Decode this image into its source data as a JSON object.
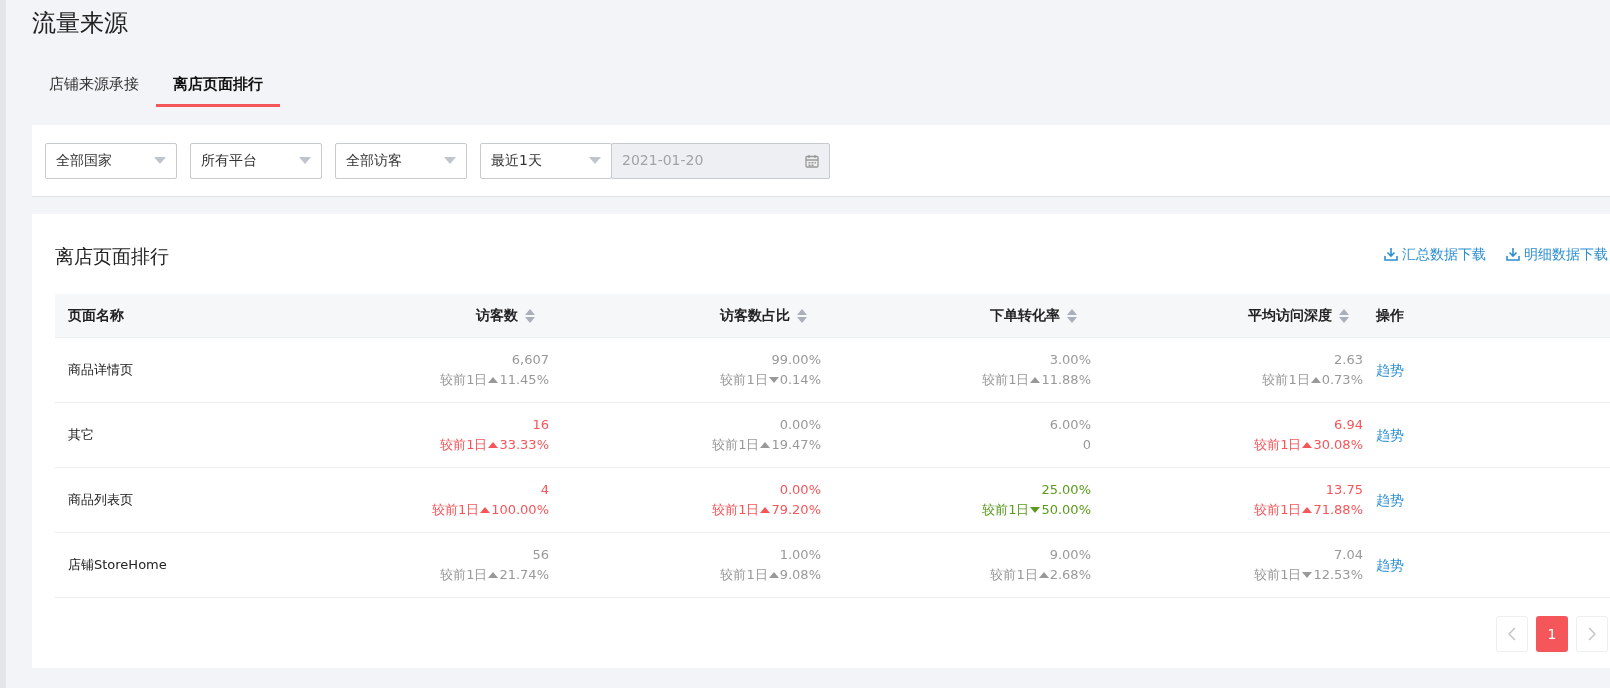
{
  "page_title": "流量来源",
  "tabs": [
    {
      "label": "店铺来源承接",
      "selected": false
    },
    {
      "label": "离店页面排行",
      "selected": true
    }
  ],
  "filters": [
    {
      "kind": "select",
      "value": "全部国家"
    },
    {
      "kind": "select",
      "value": "所有平台"
    },
    {
      "kind": "select",
      "value": "全部访客"
    },
    {
      "kind": "select",
      "value": "最近1天"
    },
    {
      "kind": "date",
      "value": "2021-01-20",
      "disabled": true
    }
  ],
  "panel": {
    "title": "离店页面排行",
    "downloads": [
      "汇总数据下载",
      "明细数据下载"
    ]
  },
  "table": {
    "columns": [
      {
        "label": "页面名称",
        "sortable": false
      },
      {
        "label": "访客数",
        "sortable": true
      },
      {
        "label": "访客数占比",
        "sortable": true
      },
      {
        "label": "下单转化率",
        "sortable": true
      },
      {
        "label": "平均访问深度",
        "sortable": true
      },
      {
        "label": "操作",
        "sortable": false
      }
    ],
    "rows": [
      {
        "name": "商品详情页",
        "action": "趋势",
        "metrics": [
          {
            "value": "6,607",
            "color": "#999999",
            "delta": {
              "kind": "up",
              "label": "较前1日",
              "change": "11.45%"
            }
          },
          {
            "value": "99.00%",
            "color": "#999999",
            "delta": {
              "kind": "down",
              "label": "较前1日",
              "change": "0.14%"
            }
          },
          {
            "value": "3.00%",
            "color": "#999999",
            "delta": {
              "kind": "up",
              "label": "较前1日",
              "change": "11.88%"
            }
          },
          {
            "value": "2.63",
            "color": "#999999",
            "delta": {
              "kind": "up",
              "label": "较前1日",
              "change": "0.73%"
            }
          }
        ]
      },
      {
        "name": "其它",
        "action": "趋势",
        "metrics": [
          {
            "value": "16",
            "color": "#f5565a",
            "delta": {
              "kind": "up",
              "label": "较前1日",
              "change": "33.33%"
            }
          },
          {
            "value": "0.00%",
            "color": "#999999",
            "delta": {
              "kind": "up",
              "label": "较前1日",
              "change": "19.47%"
            }
          },
          {
            "value": "6.00%",
            "color": "#999999",
            "delta": {
              "kind": "plain",
              "text": "0"
            }
          },
          {
            "value": "6.94",
            "color": "#f5565a",
            "delta": {
              "kind": "up",
              "label": "较前1日",
              "change": "30.08%"
            }
          }
        ]
      },
      {
        "name": "商品列表页",
        "action": "趋势",
        "metrics": [
          {
            "value": "4",
            "color": "#f5565a",
            "delta": {
              "kind": "up",
              "label": "较前1日",
              "change": "100.00%"
            }
          },
          {
            "value": "0.00%",
            "color": "#f5565a",
            "delta": {
              "kind": "up",
              "label": "较前1日",
              "change": "79.20%"
            }
          },
          {
            "value": "25.00%",
            "color": "#5a9a1c",
            "delta": {
              "kind": "down",
              "label": "较前1日",
              "change": "50.00%"
            }
          },
          {
            "value": "13.75",
            "color": "#f5565a",
            "delta": {
              "kind": "up",
              "label": "较前1日",
              "change": "71.88%"
            }
          }
        ]
      },
      {
        "name": "店铺StoreHome",
        "action": "趋势",
        "metrics": [
          {
            "value": "56",
            "color": "#999999",
            "delta": {
              "kind": "up",
              "label": "较前1日",
              "change": "21.74%"
            }
          },
          {
            "value": "1.00%",
            "color": "#999999",
            "delta": {
              "kind": "up",
              "label": "较前1日",
              "change": "9.08%"
            }
          },
          {
            "value": "9.00%",
            "color": "#999999",
            "delta": {
              "kind": "up",
              "label": "较前1日",
              "change": "2.68%"
            }
          },
          {
            "value": "7.04",
            "color": "#999999",
            "delta": {
              "kind": "down",
              "label": "较前1日",
              "change": "12.53%"
            }
          }
        ]
      }
    ]
  },
  "pagination": {
    "pages": [
      {
        "label": "1",
        "selected": true
      }
    ]
  }
}
